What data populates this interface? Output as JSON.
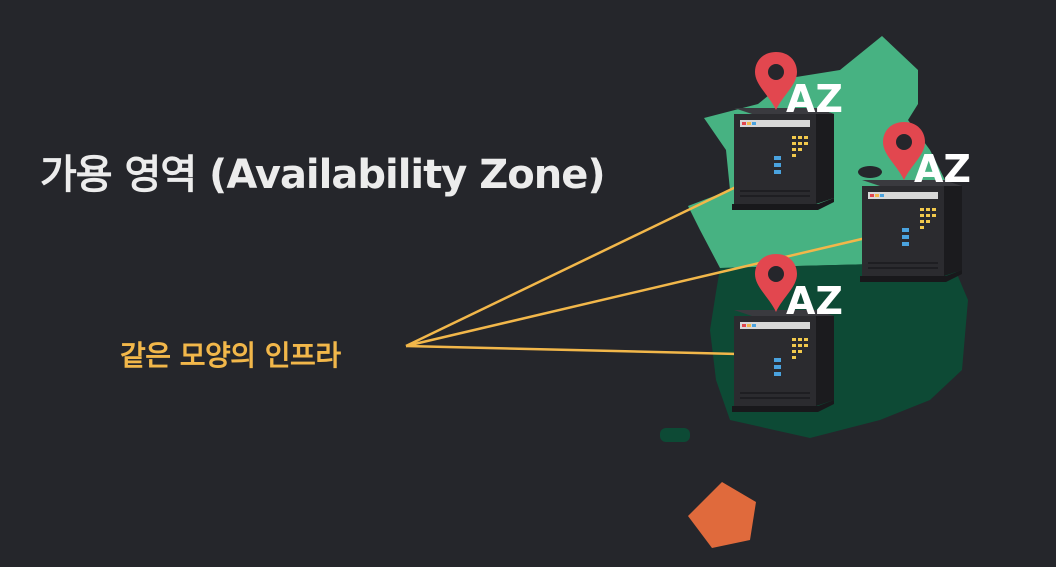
{
  "title": "가용 영역 (Availability Zone)",
  "subtitle": "같은 모양의 인프라",
  "zones": [
    {
      "label": "AZ"
    },
    {
      "label": "AZ"
    },
    {
      "label": "AZ"
    }
  ],
  "colors": {
    "background": "#25262b",
    "title": "#ececec",
    "label": "#f2b74a",
    "connector": "#f2b74a",
    "pin": "#e2474f",
    "map_north": "#47b282",
    "map_south": "#0d4a35",
    "pentagon": "#e06a3c"
  },
  "icons": [
    "server-icon",
    "map-pin-icon"
  ]
}
